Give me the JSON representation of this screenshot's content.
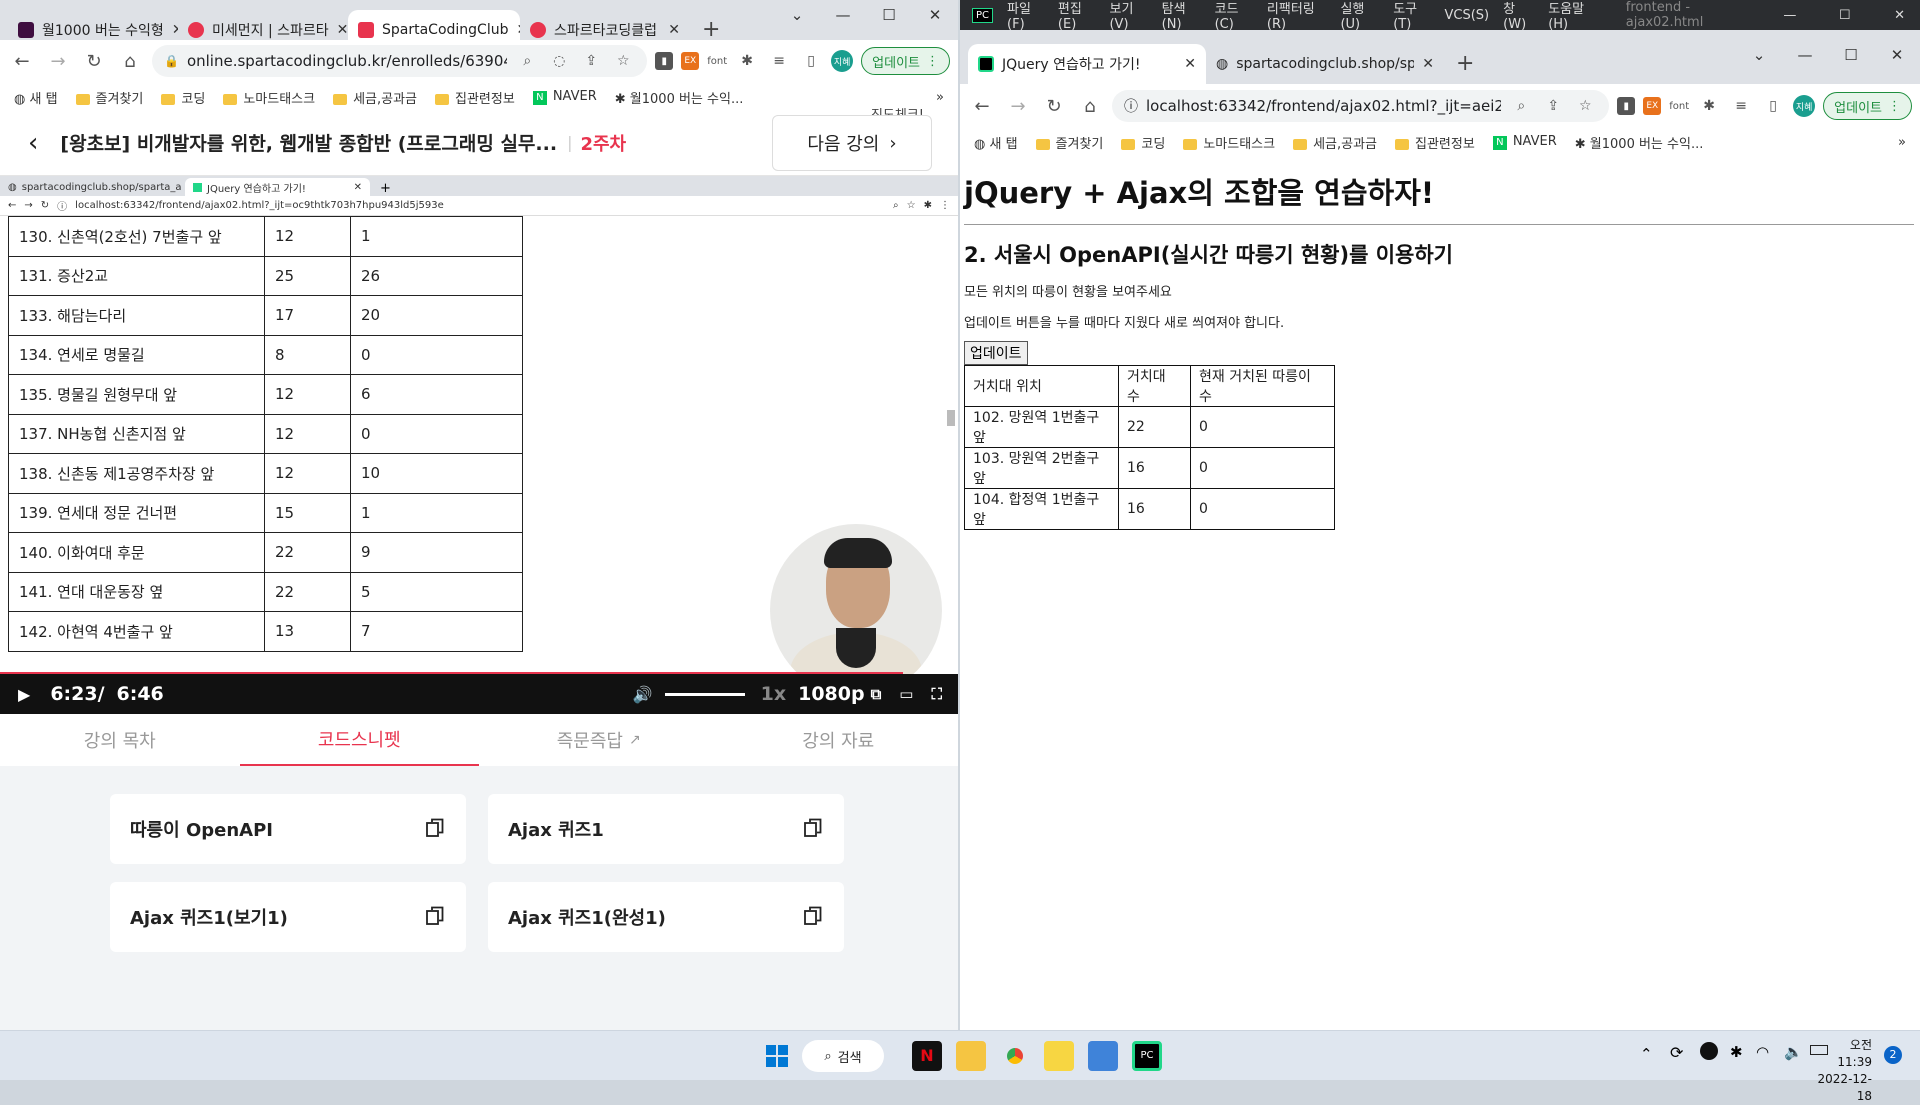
{
  "left_browser": {
    "tabs": [
      {
        "title": "월1000 버는 수익형"
      },
      {
        "title": "미세먼지 | 스파르타"
      },
      {
        "title": "SpartaCodingClub"
      },
      {
        "title": "스파르타코딩클럽"
      }
    ],
    "url": "online.spartacodingclub.kr/enrolleds/63904c4c96...",
    "font_ext": "font",
    "update_label": "업데이트",
    "profile": "지혜",
    "bookmarks": [
      "새 탭",
      "즐겨찾기",
      "코딩",
      "노마드태스크",
      "세금,공과금",
      "집관련정보",
      "NAVER",
      "월1000 버는 수익..."
    ]
  },
  "course": {
    "title": "[왕초보] 비개발자를 위한, 웹개발 종합반 (프로그래밍 실무...",
    "week": "2주차",
    "next_label": "다음 강의",
    "next_hint": "진도체크!"
  },
  "video_inner": {
    "tabs": [
      {
        "title": "spartacodingclub.shop/sparta_a"
      },
      {
        "title": "JQuery 연습하고 가기!"
      }
    ],
    "url": "localhost:63342/frontend/ajax02.html?_ijt=oc9thtk703h7hpu943ld5j593e",
    "rows": [
      {
        "name": "130. 신촌역(2호선) 7번출구 앞",
        "rack": "12",
        "bikes": "1"
      },
      {
        "name": "131. 증산2교",
        "rack": "25",
        "bikes": "26"
      },
      {
        "name": "133. 해담는다리",
        "rack": "17",
        "bikes": "20"
      },
      {
        "name": "134. 연세로 명물길",
        "rack": "8",
        "bikes": "0"
      },
      {
        "name": "135. 명물길 원형무대 앞",
        "rack": "12",
        "bikes": "6"
      },
      {
        "name": "137. NH농협 신촌지점 앞",
        "rack": "12",
        "bikes": "0"
      },
      {
        "name": "138. 신촌동 제1공영주차장 앞",
        "rack": "12",
        "bikes": "10"
      },
      {
        "name": "139. 연세대 정문 건너편",
        "rack": "15",
        "bikes": "1"
      },
      {
        "name": "140. 이화여대 후문",
        "rack": "22",
        "bikes": "9"
      },
      {
        "name": "141. 연대 대운동장 옆",
        "rack": "22",
        "bikes": "5"
      },
      {
        "name": "142. 아현역 4번출구 앞",
        "rack": "13",
        "bikes": "7"
      }
    ]
  },
  "player": {
    "current": "6:23/",
    "duration": "6:46",
    "progress": 0.943,
    "speed": "1x",
    "quality": "1080p"
  },
  "snippet_tabs": [
    {
      "label": "강의 목차",
      "active": false
    },
    {
      "label": "코드스니펫",
      "active": true
    },
    {
      "label": "즉문즉답",
      "active": false
    },
    {
      "label": "강의 자료",
      "active": false
    }
  ],
  "snippets": [
    {
      "label": "따릉이 OpenAPI"
    },
    {
      "label": "Ajax 퀴즈1"
    },
    {
      "label": "Ajax 퀴즈1(보기1)"
    },
    {
      "label": "Ajax 퀴즈1(완성1)"
    }
  ],
  "ide_menu": [
    "파일(F)",
    "편집(E)",
    "보기(V)",
    "탐색(N)",
    "코드(C)",
    "리팩터링(R)",
    "실행(U)",
    "도구(T)",
    "VCS(S)",
    "창(W)",
    "도움말(H)"
  ],
  "ide_title": "frontend - ajax02.html",
  "right_browser": {
    "tabs": [
      {
        "title": "JQuery 연습하고 가기!"
      },
      {
        "title": "spartacodingclub.shop/sparta_a"
      }
    ],
    "url": "localhost:63342/frontend/ajax02.html?_ijt=aei2al3njsq...",
    "update_label": "업데이트",
    "profile": "지혜",
    "font_ext": "font",
    "bookmarks": [
      "새 탭",
      "즐겨찾기",
      "코딩",
      "노마드태스크",
      "세금,공과금",
      "집관련정보",
      "NAVER",
      "월1000 버는 수익..."
    ]
  },
  "page": {
    "h1": "jQuery + Ajax의 조합을 연습하자!",
    "h2": "2. 서울시 OpenAPI(실시간 따릉기 현황)를 이용하기",
    "p1": "모든 위치의 따릉이 현황을 보여주세요",
    "p2": "업데이트 버튼을 누를 때마다 지웠다 새로 씌여져야 합니다.",
    "button": "업데이트",
    "headers": [
      "거치대 위치",
      "거치대 수",
      "현재 거치된 따릉이 수"
    ],
    "rows": [
      {
        "name": "102. 망원역 1번출구 앞",
        "rack": "22",
        "bikes": "0"
      },
      {
        "name": "103. 망원역 2번출구 앞",
        "rack": "16",
        "bikes": "0"
      },
      {
        "name": "104. 합정역 1번출구 앞",
        "rack": "16",
        "bikes": "0"
      }
    ]
  },
  "taskbar": {
    "search": "검색",
    "time": "오전 11:39",
    "date": "2022-12-18",
    "notifications": "2"
  }
}
